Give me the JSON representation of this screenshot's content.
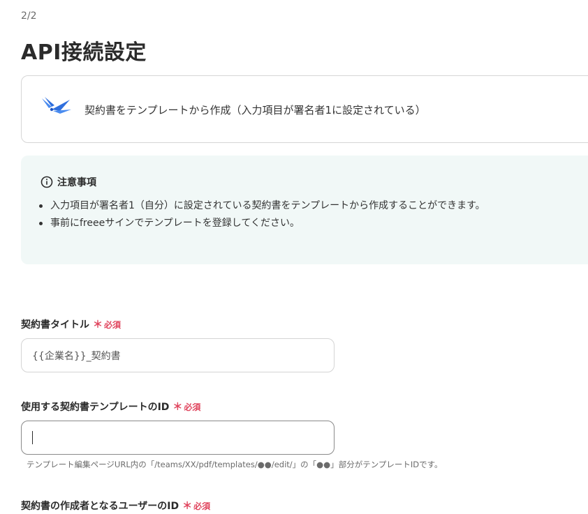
{
  "header": {
    "step": "2/2",
    "title": "API接続設定"
  },
  "action": {
    "label": "契約書をテンプレートから作成（入力項目が署名者1に設定されている）",
    "icon": "freee-sign-logo-icon"
  },
  "notice": {
    "title": "注意事項",
    "items": [
      "入力項目が署名者1（自分）に設定されている契約書をテンプレートから作成することができます。",
      "事前にfreeeサインでテンプレートを登録してください。"
    ]
  },
  "fields": [
    {
      "label": "契約書タイトル",
      "required_mark": "＊",
      "required_text": "必須",
      "value": "{{企業名}}_契約書"
    },
    {
      "label": "使用する契約書テンプレートのID",
      "required_mark": "＊",
      "required_text": "必須",
      "value": "",
      "hint": "テンプレート編集ページURL内の「/teams/XX/pdf/templates/●●/edit/」の「●●」部分がテンプレートIDです。"
    },
    {
      "label": "契約書の作成者となるユーザーのID",
      "required_mark": "＊",
      "required_text": "必須"
    }
  ],
  "colors": {
    "required": "#e0455e",
    "notice_bg": "#f1f8f7",
    "logo_blue": "#2f6fde"
  }
}
